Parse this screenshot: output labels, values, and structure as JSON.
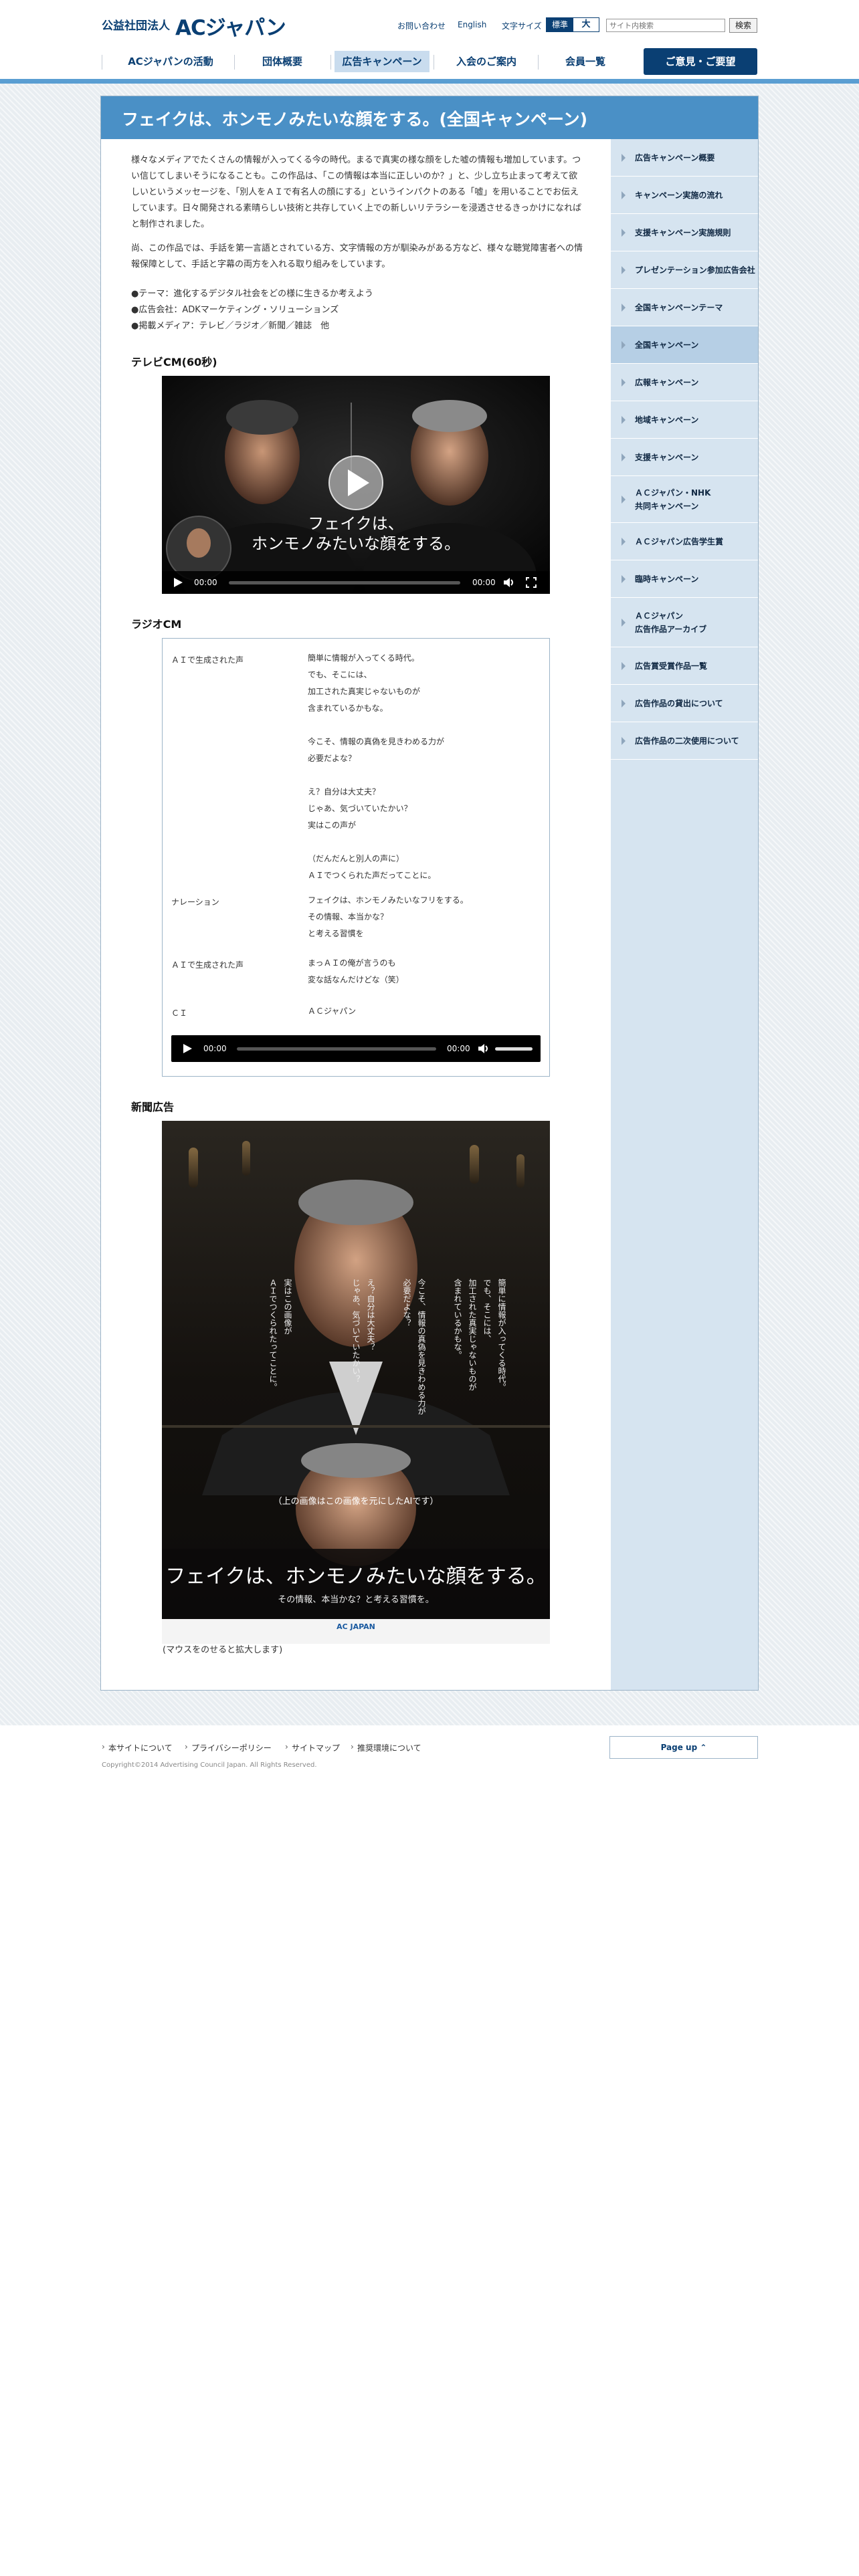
{
  "header": {
    "logo_prefix": "公益社団法人",
    "logo_main": "ACジャパン",
    "utility_links": [
      "お問い合わせ",
      "English"
    ],
    "font_size_label": "文字サイズ",
    "font_size_standard": "標準",
    "font_size_large": "大",
    "search_placeholder": "サイト内検索",
    "search_button": "検索"
  },
  "nav": {
    "items": [
      "ACジャパンの活動",
      "団体概要",
      "広告キャンペーン",
      "入会のご案内",
      "会員一覧"
    ],
    "active_index": 2,
    "contact_button": "ご意見・ご要望"
  },
  "page": {
    "title": "フェイクは、ホンモノみたいな顔をする。(全国キャンペーン)"
  },
  "article": {
    "paragraph1": "様々なメディアでたくさんの情報が入ってくる今の時代。まるで真実の様な顔をした嘘の情報も増加しています。つい信じてしまいそうになることも。この作品は、「この情報は本当に正しいのか？」と、少し立ち止まって考えて欲しいというメッセージを、「別人をＡＩで有名人の顔にする」というインパクトのある「嘘」を用いることでお伝えしています。日々開発される素晴らしい技術と共存していく上での新しいリテラシーを浸透させるきっかけになればと制作されました。",
    "paragraph2": "尚、この作品では、手話を第一言語とされている方、文字情報の方が馴染みがある方など、様々な聴覚障害者への情報保障として、手話と字幕の両方を入れる取り組みをしています。",
    "bullets": [
      "●テーマ：進化するデジタル社会をどの様に生きるか考えよう",
      "●広告会社：ADKマーケティング・ソリューションズ",
      "●掲載メディア：テレビ／ラジオ／新聞／雑誌　他"
    ],
    "tv_heading": "テレビCM(60秒)",
    "radio_heading": "ラジオCM",
    "newspaper_heading": "新聞広告",
    "newspaper_caption": "(マウスをのせると拡大します)"
  },
  "video": {
    "subtitle_line1": "フェイクは、",
    "subtitle_line2": "ホンモノみたいな顔をする。",
    "time_current": "00:00",
    "time_total": "00:00"
  },
  "radio": {
    "rows": [
      {
        "role": "ＡＩで生成された声",
        "lines": "簡単に情報が入ってくる時代。\nでも、そこには、\n加工された真実じゃないものが\n含まれているかもな。\n\n今こそ、情報の真偽を見きわめる力が\n必要だよな？\n\nえ？自分は大丈夫？\nじゃあ、気づいていたかい？\n実はこの声が\n\n（だんだんと別人の声に）\nＡＩでつくられた声だってことに。"
      },
      {
        "role": "ナレーション",
        "lines": "フェイクは、ホンモノみたいなフリをする。\nその情報、本当かな？\nと考える習慣を"
      },
      {
        "role": "ＡＩで生成された声",
        "lines": "まっＡＩの俺が言うのも\n変な話なんだけどな（笑）"
      },
      {
        "role": "ＣＩ",
        "lines": "ＡＣジャパン"
      }
    ],
    "audio_time_current": "00:00",
    "audio_time_total": "00:00"
  },
  "newspaper_ad": {
    "vertical_text": [
      "簡単に情報が入ってくる時代。",
      "でも、そこには、",
      "加工された真実じゃないものが",
      "含まれているかもな。",
      "今こそ、情報の真偽を見きわめる力が",
      "必要だよな？",
      "え？自分は大丈夫？",
      "じゃあ、気づいていたかい？",
      "実はこの画像が",
      "ＡＩでつくられたってことに。"
    ],
    "note": "（上の画像はこの画像を元にしたAIです）",
    "headline": "フェイクは、ホンモノみたいな顔をする。",
    "subline": "その情報、本当かな？と考える習慣を。",
    "logo": "AC JAPAN"
  },
  "sidebar": {
    "items": [
      "広告キャンペーン概要",
      "キャンペーン実施の流れ",
      "支援キャンペーン実施規則",
      "プレゼンテーション参加広告会社",
      "全国キャンペーンテーマ",
      "全国キャンペーン",
      "広報キャンペーン",
      "地域キャンペーン",
      "支援キャンペーン",
      "ＡＣジャパン・NHK\n共同キャンペーン",
      "ＡＣジャパン広告学生賞",
      "臨時キャンペーン",
      "ＡＣジャパン\n広告作品アーカイブ",
      "広告賞受賞作品一覧",
      "広告作品の貸出について",
      "広告作品の二次使用について"
    ],
    "active_index": 5
  },
  "footer": {
    "links": [
      "本サイトについて",
      "プライバシーポリシー",
      "サイトマップ",
      "推奨環境について"
    ],
    "page_up": "Page up",
    "copyright": "Copyright©2014 Advertising Council Japan. All Rights Reserved."
  },
  "colors": {
    "brand_navy": "#0a3f73",
    "title_bar": "#4a90c6",
    "sidebar_bg": "#d6e4f0",
    "sidebar_active": "#b6cfe5"
  }
}
